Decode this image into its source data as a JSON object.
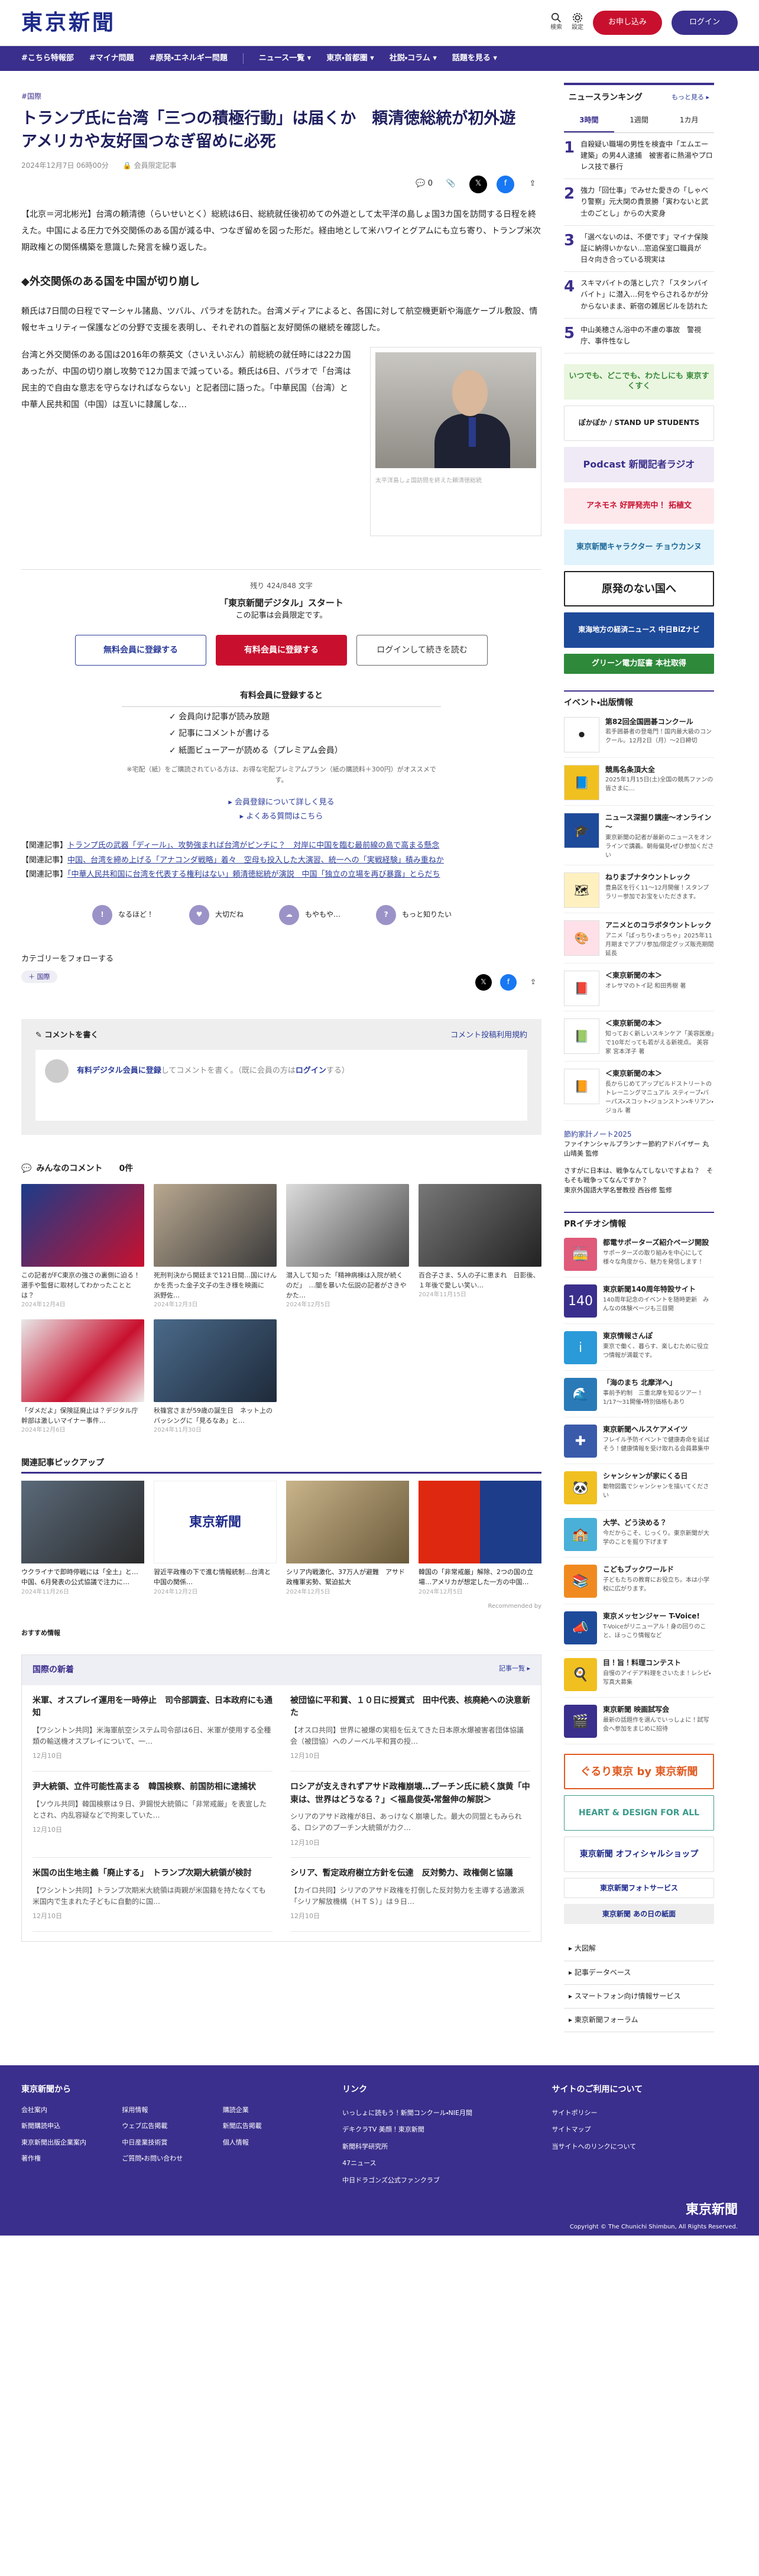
{
  "header": {
    "logo": "東京新聞",
    "search": "検索",
    "settings": "設定",
    "trial": "お申し込み",
    "login": "ログイン"
  },
  "nav": [
    "#こちら特報部",
    "#マイナ問題",
    "#原発・エネルギー問題",
    "ニュース一覧 ▾",
    "東京・首都圏 ▾",
    "社説・コラム ▾",
    "話題を見る ▾"
  ],
  "article": {
    "tag": "#国際",
    "title": "トランプ氏に台湾「三つの積極行動」は届くか　頼清徳総統が初外遊　アメリカや友好国つなぎ留めに必死",
    "date": "2024年12月7日 06時00分",
    "member": "会員限定記事",
    "comment_count": "0",
    "p1": "【北京＝河北彬光】台湾の頼清徳（らいせいとく）総統は6日、総統就任後初めての外遊として太平洋の島しょ国3カ国を訪問する日程を終えた。中国による圧力で外交関係のある国が減る中、つなぎ留めを図った形だ。経由地として米ハワイとグアムにも立ち寄り、トランプ米次期政権との関係構築を意識した発言を繰り返した。",
    "h2": "◆外交関係のある国を中国が切り崩し",
    "p2": "頼氏は7日間の日程でマーシャル諸島、ツバル、パラオを訪れた。台湾メディアによると、各国に対して航空機更新や海底ケーブル敷設、情報セキュリティー保護などの分野で支援を表明し、それぞれの首脳と友好関係の継続を確認した。",
    "p3": "台湾と外交関係のある国は2016年の蔡英文（さいえいぶん）前総統の就任時には22カ国あったが、中国の切り崩し攻勢で12カ国まで減っている。頼氏は6日、パラオで「台湾は民主的で自由な意志を守らなければならない」と記者団に語った。「中華民国（台湾）と中華人民共和国（中国）は互いに隷属しな…",
    "photo_caption": "太平洋島しょ国訪問を終えた頼清徳総統"
  },
  "paywall": {
    "remaining": "残り 424/848 文字",
    "service": "「東京新聞デジタル」スタート",
    "note": "この記事は会員限定です。",
    "free_btn": "無料会員に登録する",
    "paid_btn": "有料会員に登録する",
    "login_btn": "ログインして続きを読む",
    "benefit_title": "有料会員に登録すると",
    "benefits": [
      "✓ 会員向け記事が読み放題",
      "✓ 記事にコメントが書ける",
      "✓ 紙面ビューアーが読める（プレミアム会員）"
    ],
    "benefit_note": "※宅配（紙）をご購読されている方は、お得な宅配プレミアムプラン（紙の購読料＋300円）がオススメです。",
    "link1": "▸ 会員登録について詳しく見る",
    "link2": "▸ よくある質問はこちら"
  },
  "related": [
    {
      "label": "【関連記事】",
      "text": "トランプ氏の武器「ディール」、攻勢強まれば台湾がピンチに？　対岸に中国を臨む最前線の島で高まる懸念"
    },
    {
      "label": "【関連記事】",
      "text": "中国、台湾を締め上げる「アナコンダ戦略」着々　空母も投入した大演習、統一への「実戦経験」積み重ねか"
    },
    {
      "label": "【関連記事】",
      "text": "「中華人民共和国に台湾を代表する権利はない」頼清徳総統が演説　中国「独立の立場を再び暴露」とらだち"
    }
  ],
  "reactions": [
    "なるほど！",
    "大切だね",
    "もやもや…",
    "もっと知りたい"
  ],
  "follow": {
    "title": "カテゴリーをフォローする",
    "chip": "＋ 国際"
  },
  "comment": {
    "title": "コメントを書く",
    "rules": "コメント投稿利用規約",
    "prompt_pre": "有料デジタル会員に登録",
    "prompt_mid": "してコメントを書く。（既に会員の方は",
    "prompt_login": "ログイン",
    "prompt_end": "する）"
  },
  "comments": {
    "title": "みんなのコメント",
    "count": "0件",
    "items": [
      {
        "text": "この記者がFC東京の強さの裏側に迫る！選手や監督に取材してわかったこととは？",
        "date": "2024年12月4日"
      },
      {
        "text": "死刑判決から開廷まで121日間…国にけんかを売った金子文子の生き様を映画に　浜野佐…",
        "date": "2024年12月3日"
      },
      {
        "text": "潜入して知った「精神病棟は入院が続くのだ」　…闇を暴いた伝説の記者がさきやかた…",
        "date": "2024年12月5日"
      },
      {
        "text": "百合子さま、5人の子に恵まれ　日影後、１年後で愛しい笑い…",
        "date": "2024年11月15日"
      },
      {
        "text": "「ダメだよ」保険証廃止は？デジタル庁幹部は激しいマイナー事件…",
        "date": "2024年12月6日"
      },
      {
        "text": "秋篠宮さまが59歳の誕生日　ネット上のバッシングに「見るなあ」と…",
        "date": "2024年11月30日"
      }
    ]
  },
  "picks": {
    "title": "関連記事ピックアップ",
    "items": [
      {
        "text": "ウクライナで即時停戦には「全土」と…　中国、6月発表の公式協議で注力に…",
        "date": "2024年11月26日"
      },
      {
        "text": "習近平政権の下で進む情報統制…台湾と中国の関係…",
        "date": "2024年12月2日"
      },
      {
        "text": "シリア内戦激化、37万人が避難　アサド政権軍劣勢、緊迫拡大",
        "date": "2024年12月5日"
      },
      {
        "text": "韓国の「非常戒厳」解除、2つの国の立場…アメリカが想定した一方の中国…",
        "date": "2024年12月5日"
      }
    ],
    "recommended": "Recommended by",
    "logo": "東京新聞"
  },
  "osusume": "おすすめ情報",
  "world": {
    "title": "国際の新着",
    "more": "記事一覧 ▸",
    "items": [
      {
        "title": "米軍、オスプレイ運用を一時停止　司令部調査、日本政府にも通知",
        "body": "【ワシントン共同】米海軍航空システム司令部は6日、米軍が使用する全種類の輸送機オスプレイについて、一…",
        "date": "12月10日"
      },
      {
        "title": "被団協に平和賞、１０日に授賞式　田中代表、核廃絶への決意新た",
        "body": "【オスロ共同】世界に被爆の実相を伝えてきた日本原水爆被害者団体協議会（被団協）へのノーベル平和賞の授…",
        "date": "12月10日"
      },
      {
        "title": "尹大統領、立件可能性高まる　韓国検察、前国防相に逮捕状",
        "body": "【ソウル共同】韓国検察は９日、尹錫悦大統領に「非常戒厳」を表宣したとされ、内乱容疑などで拘束していた…",
        "date": "12月10日"
      },
      {
        "title": "ロシアが支えきれずアサド政権崩壊…プーチン氏に続く旗黄「中東は、世界はどうなる？」＜福島俊英・常盤伸の解説＞",
        "body": "シリアのアサド政権が8日、あっけなく崩壊した。最大の同盟ともみられる、ロシアのプーチン大統領が力ク…",
        "date": "12月10日"
      },
      {
        "title": "米国の出生地主義「廃止する」　トランプ次期大統領が検討",
        "body": "【ワシントン共同】トランプ次期米大統領は両親が米国籍を持たなくても米国内で生まれた子どもに自動的に国…",
        "date": "12月10日"
      },
      {
        "title": "シリア、暫定政府樹立方針を伝達　反対勢力、政権側と協議",
        "body": "【カイロ共同】シリアのアサド政権を打倒した反対勢力を主導する過激派「シリア解放機構（ＨＴＳ）」は９日…",
        "date": "12月10日"
      }
    ]
  },
  "sidebar": {
    "ranking_title": "ニュースランキング",
    "ranking_more": "もっと見る ▸",
    "tabs": [
      "3時間",
      "1週間",
      "1カ月"
    ],
    "ranks": [
      {
        "n": "1",
        "t": "自殺疑い職場の男性を検査中「エムエー建築」の男4人逮捕　被害者に熱湯やプロレス技で暴行"
      },
      {
        "n": "2",
        "t": "強力「回仕事」でみせた愛きの「しゃべり警察」元大関の貴景勝「寅わないと武士のごとし」からの大変身"
      },
      {
        "n": "3",
        "t": "「選べないのは、不便です」マイナ保険証に納得いかない…窓追保室口職員が日々向き合っている現実は"
      },
      {
        "n": "4",
        "t": "スキマバイトの落とし穴？「スタンバイバイト」に潜入…何をやらされるかが分からないまま、新宿の雑居ビルを訪れた"
      },
      {
        "n": "5",
        "t": "中山美穂さん浴中の不慮の事故　警視庁、事件性なし"
      }
    ],
    "banners": [
      "いつでも、どこでも、わたしにも 東京すくすく",
      "ぽかぽか / STAND UP STUDENTS",
      "Podcast 新聞記者ラジオ",
      "アネモネ 好評発売中！ 拓植文",
      "東京新聞キャラクター チョウカンヌ",
      "原発のない国へ",
      "東海地方の経済ニュース 中日BiZナビ",
      "グリーン電力証書 本社取得"
    ],
    "events_title": "イベント・出版情報",
    "events": [
      {
        "t": "第82回全国囲碁コンクール",
        "p": "若手囲碁者の登竜門！国内最大級のコンクール。12月2日（月）～2日締切"
      },
      {
        "t": "競馬名条頂大全",
        "p": "2025年1月15日(土)全国の競馬ファンの皆さまに…"
      },
      {
        "t": "ニュース深掘り講座～オンライン～",
        "p": "東京新聞の記者が最新のニュースをオンラインで講義。朝毎偏見・ぜひ参加ください"
      },
      {
        "t": "ねりまブナタウントレック",
        "p": "豊島区を行く11～12月開催！スタンプラリー参加でお宝をいただきます。"
      },
      {
        "t": "アニメとのコラボタウントレック",
        "p": "アニメ「ぱっちり・まっちゃ」2025年11月期までアプリ参加/限定グッズ販売期間延長"
      },
      {
        "t": "＜東京新聞の本＞",
        "p": "オレサマのトイ記\n和田秀樹 著"
      },
      {
        "t": "＜東京新聞の本＞",
        "p": "知っておく新しいスキンケア「美容医療」で10年だっても若がえる新視点。\n美容家 宮本洋子 著"
      },
      {
        "t": "＜東京新聞の本＞",
        "p": "長からじめてアップビルドストリートのトレーニングマニュアル\nスティーブ・バーパス・スコット・ジョンストン・キリアン・ジョル 著"
      }
    ],
    "budget_link": "節約家計ノート2025",
    "budget_sub": "ファイナンシャルプランナー節約アドバイザー 丸山晴美 監修",
    "book_line": "さすがに日本は、戦争なんてしないですよね？　そもそも戦争ってなんですか？",
    "book_author": "東京外国語大学名誉教授 西谷修 監修",
    "pr_title": "PRイチオシ情報",
    "pr": [
      {
        "t": "都電サポーターズ紹介ページ開設",
        "p": "サポーターズの取り組みを中心にして様々な角度から、魅力を発信します！"
      },
      {
        "t": "東京新聞140周年特設サイト",
        "p": "140周年記念のイベントを随時更新　みんなの体験ページも三目開"
      },
      {
        "t": "東京情報さんぽ",
        "p": "東京で働く、暮らす、楽しむために役立つ情報が満載です。"
      },
      {
        "t": "「海のまち 北摩洋へ」",
        "p": "事前予約制　三重北摩を知るツアー！1/17～31開催・特別価格もあり"
      },
      {
        "t": "東京新聞ヘルスケアメイツ",
        "p": "フレイル予防イベントで健康寿命を延ばそう！健康情報を受け取れる会員募集中"
      },
      {
        "t": "シャンシャンが家にくる日",
        "p": "動物図鑑でシャンシャンを描いてください"
      },
      {
        "t": "大学、どう決める？",
        "p": "今だからこそ、じっくり。東京新聞が大学のことを掘り下げます"
      },
      {
        "t": "こどもブックワールド",
        "p": "子どもたちの教育にお役立ち。本は小学校に広がります。"
      },
      {
        "t": "東京メッセンジャー T-Voice!",
        "p": "T-Voiceがリニューアル！身の回りのこと、ほっこり情報など"
      },
      {
        "t": "目！旨！料理コンテスト",
        "p": "自慢のアイデア料理をさいたま！レシピ・写真大募集"
      },
      {
        "t": "東京新聞 映画試写会",
        "p": "最新の話題作を選んでいっしょに！試写会へ参加をまじめに招待"
      }
    ],
    "side_banners": [
      "ぐるり東京 by 東京新聞",
      "HEART & DESIGN FOR ALL",
      "東京新聞 オフィシャルショップ",
      "東京新聞フォトサービス",
      "東京新聞 あの日の紙面"
    ],
    "links": [
      "▸ 大図解",
      "▸ 記事データベース",
      "▸ スマートフォン向け情報サービス",
      "▸ 東京新聞フォーラム"
    ]
  },
  "footer": {
    "col1_title": "東京新聞から",
    "col1": [
      "会社案内",
      "採用情報",
      "購読企業",
      "新聞購読申込",
      "ウェブ広告掲載",
      "新聞広告掲載",
      "東京新聞出版企業案内",
      "中日産業技術賞",
      "個人情報",
      "著作権",
      "ご質問・お問い合わせ"
    ],
    "col2_title": "リンク",
    "col2": [
      "いっしょに読もう！新聞コンクール・NIE月間",
      "デキクラTV 美顔！東京新聞",
      "新聞科学研究所",
      "47ニュース",
      "中日ドラゴンズ公式ファンクラブ"
    ],
    "col3_title": "サイトのご利用について",
    "col3": [
      "サイトポリシー",
      "サイトマップ",
      "当サイトへのリンクについて"
    ],
    "logo": "東京新聞",
    "copy": "Copyright © The Chunichi Shimbun, All Rights Reserved."
  },
  "colors": {
    "navy": "#3a2f8c",
    "red": "#c8102e",
    "logo": "#1d2a8a"
  }
}
